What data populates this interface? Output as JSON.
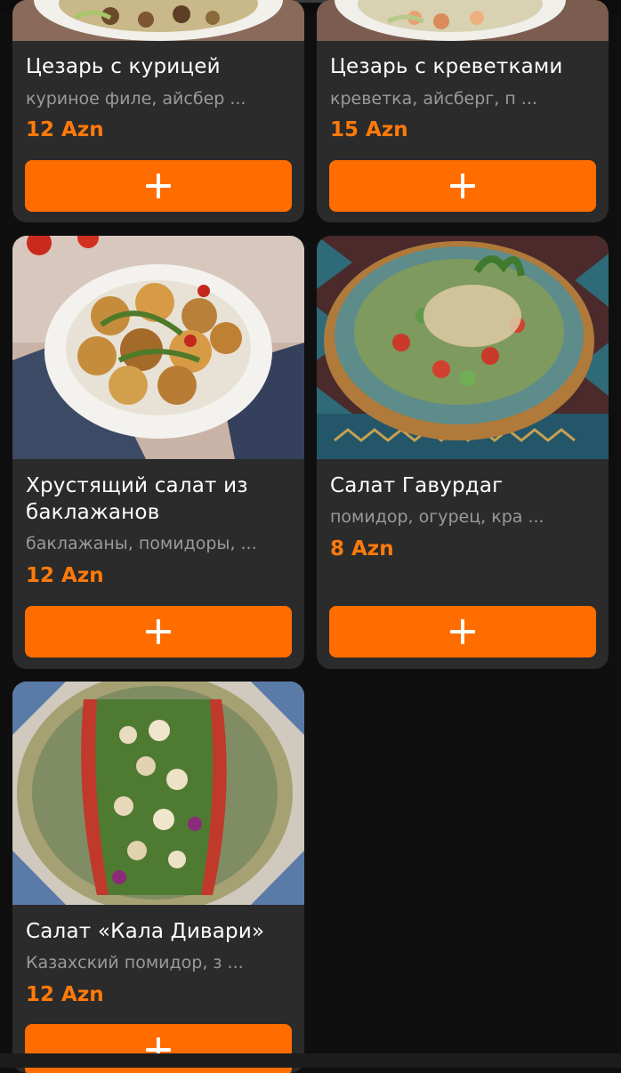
{
  "items": [
    {
      "title": "Цезарь с курицей",
      "desc": "куриное филе, айсбер ...",
      "price": "12 Azn"
    },
    {
      "title": "Цезарь с креветками",
      "desc": "креветка, айсберг, п ...",
      "price": "15 Azn"
    },
    {
      "title": "Хрустящий салат из баклажанов",
      "desc": "баклажаны, помидоры, ...",
      "price": "12 Azn"
    },
    {
      "title": "Салат Гавурдаг",
      "desc": "помидор, огурец, кра ...",
      "price": "8 Azn"
    },
    {
      "title": "Салат «Кала Дивари»",
      "desc": "Казахский помидор, з ...",
      "price": "12 Azn"
    }
  ],
  "add_button_icon": "plus-icon",
  "colors": {
    "accent": "#ff6d00",
    "price": "#ff7a0a",
    "card": "#2b2b2b",
    "background": "#0f0f0f"
  }
}
